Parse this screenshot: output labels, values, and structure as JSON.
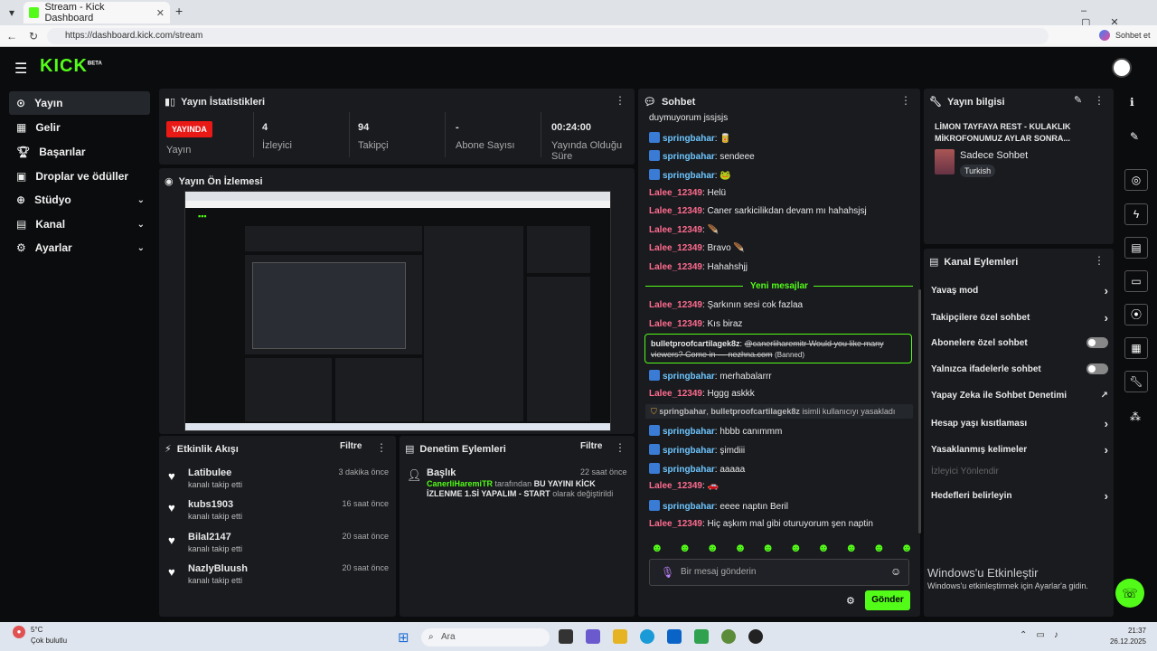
{
  "browser": {
    "tab_title": "Stream - Kick Dashboard",
    "url": "https://dashboard.kick.com/stream",
    "copilot_label": "Sohbet et"
  },
  "logo": {
    "text": "KICK",
    "beta": "BETA"
  },
  "sidebar": {
    "items": [
      {
        "label": "Yayın",
        "icon": "broadcast-icon",
        "active": true
      },
      {
        "label": "Gelir",
        "icon": "revenue-icon"
      },
      {
        "label": "Başarılar",
        "icon": "trophy-icon"
      },
      {
        "label": "Droplar ve ödüller",
        "icon": "gift-icon"
      },
      {
        "label": "Stüdyo",
        "icon": "studio-icon",
        "expandable": true
      },
      {
        "label": "Kanal",
        "icon": "channel-icon",
        "expandable": true
      },
      {
        "label": "Ayarlar",
        "icon": "gear-icon",
        "expandable": true
      }
    ]
  },
  "stats": {
    "title": "Yayın İstatistikleri",
    "live_badge": "YAYINDA",
    "live_label": "Yayın",
    "viewers": {
      "value": "4",
      "label": "İzleyici"
    },
    "followers": {
      "value": "94",
      "label": "Takipçi"
    },
    "subs": {
      "value": "-",
      "label": "Abone Sayısı"
    },
    "uptime": {
      "value": "00:24:00",
      "label": "Yayında Olduğu Süre"
    }
  },
  "preview": {
    "title": "Yayın Ön İzlemesi"
  },
  "activity": {
    "title": "Etkinlik Akışı",
    "filter": "Filtre",
    "items": [
      {
        "name": "Latibulee",
        "sub": "kanalı takip etti",
        "time": "3 dakika önce"
      },
      {
        "name": "kubs1903",
        "sub": "kanalı takip etti",
        "time": "16 saat önce"
      },
      {
        "name": "Bilal2147",
        "sub": "kanalı takip etti",
        "time": "20 saat önce"
      },
      {
        "name": "NazlyBluush",
        "sub": "kanalı takip etti",
        "time": "20 saat önce"
      }
    ]
  },
  "moderation": {
    "title": "Denetim Eylemleri",
    "filter": "Filtre",
    "item": {
      "heading": "Başlık",
      "time": "22 saat önce",
      "actor": "CanerliHaremiTR",
      "by": "tarafından",
      "text": "BU YAYINI KİCK İZLENME 1.Sİ YAPALIM - START",
      "suffix": "olarak değiştirildi"
    }
  },
  "chat": {
    "title": "Sohbet",
    "new_messages": "Yeni mesajlar",
    "placeholder": "Bir mesaj gönderin",
    "send": "Gönder",
    "banned_user": "bulletproofcartilagek8z",
    "banned_text": "@canerliharemitr Would you like many viewers? Come in — nezhna.com",
    "banned_tag": "(Banned)",
    "ban_notice_actor": "springbahar",
    "ban_notice_target": "bulletproofcartilagek8z",
    "ban_notice_text": "isimli kullanıcıyı yasakladı",
    "messages_top": [
      {
        "user": "",
        "text": "duymuyorum jssjsjs"
      },
      {
        "user": "springbahar",
        "text": "🥫"
      },
      {
        "user": "springbahar",
        "text": "sendeee"
      },
      {
        "user": "springbahar",
        "text": "🐸"
      },
      {
        "user": "Lalee_12349",
        "text": "Helü"
      },
      {
        "user": "Lalee_12349",
        "text": "Caner sarkicilikdan devam mı hahahsjsj"
      },
      {
        "user": "Lalee_12349",
        "text": "🪶"
      },
      {
        "user": "Lalee_12349",
        "text": "Bravo 🪶"
      },
      {
        "user": "Lalee_12349",
        "text": "Hahahshjj"
      }
    ],
    "messages_mid": [
      {
        "user": "Lalee_12349",
        "text": "Şarkının sesi cok fazlaa"
      },
      {
        "user": "Lalee_12349",
        "text": "Kıs biraz"
      }
    ],
    "messages_bottom": [
      {
        "user": "springbahar",
        "text": "merhabalarrr"
      },
      {
        "user": "Lalee_12349",
        "text": "Hggg askkk"
      }
    ],
    "messages_end": [
      {
        "user": "springbahar",
        "text": "hbbb canımmm"
      },
      {
        "user": "springbahar",
        "text": "şimdiii"
      },
      {
        "user": "springbahar",
        "text": "aaaaa"
      },
      {
        "user": "Lalee_12349",
        "text": "🚗"
      },
      {
        "user": "springbahar",
        "text": "eeee naptın Beril"
      },
      {
        "user": "Lalee_12349",
        "text": "Hiç aşkım mal gibi oturuyorum şen naptin"
      }
    ]
  },
  "stream_info": {
    "title": "Yayın bilgisi",
    "stream_title": "LİMON TAYFAYA REST - KULAKLIK MİKROFONUMUZ AYLAR SONRA...",
    "category": "Sadece Sohbet",
    "language": "Turkish"
  },
  "channel_actions": {
    "title": "Kanal Eylemleri",
    "items": [
      {
        "label": "Yavaş mod",
        "control": "chevron"
      },
      {
        "label": "Takipçilere özel sohbet",
        "control": "chevron"
      },
      {
        "label": "Abonelere özel sohbet",
        "control": "toggle",
        "on": false
      },
      {
        "label": "Yalnızca ifadelerle sohbet",
        "control": "toggle",
        "on": false
      },
      {
        "label": "Yapay Zeka ile Sohbet Denetimi",
        "control": "external"
      },
      {
        "label": "Hesap yaşı kısıtlaması",
        "control": "chevron"
      },
      {
        "label": "Yasaklanmış kelimeler",
        "control": "chevron"
      },
      {
        "label": "İzleyici Yönlendir",
        "control": "none",
        "disabled": true
      },
      {
        "label": "Hedefleri belirleyin",
        "control": "chevron"
      }
    ]
  },
  "windows_watermark": {
    "title": "Windows'u Etkinleştir",
    "sub": "Windows'u etkinleştirmek için Ayarlar'a gidin."
  },
  "taskbar": {
    "weather_temp": "5°C",
    "weather_text": "Çok bulutlu",
    "search": "Ara",
    "time": "21:37",
    "date": "26.12.2025"
  }
}
